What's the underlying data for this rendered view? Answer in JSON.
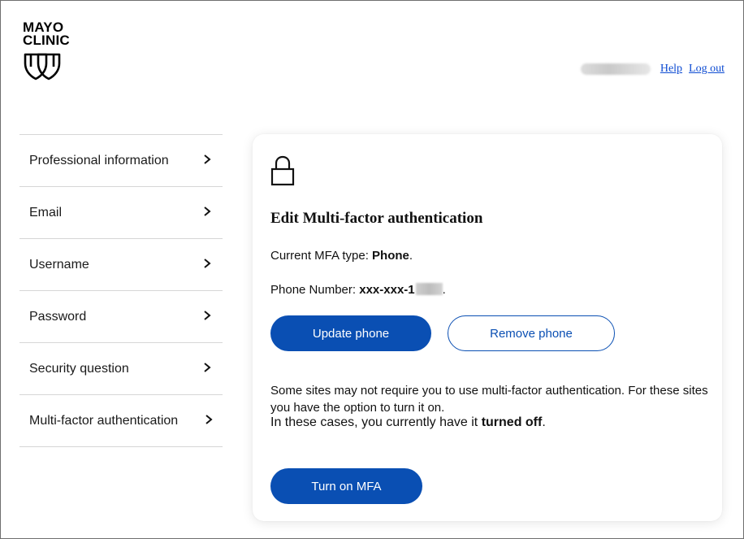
{
  "header": {
    "logo_line1": "MAYO",
    "logo_line2": "CLINIC",
    "help_label": "Help",
    "logout_label": "Log out"
  },
  "sidebar": {
    "items": [
      {
        "label": "Professional information"
      },
      {
        "label": "Email"
      },
      {
        "label": "Username"
      },
      {
        "label": "Password"
      },
      {
        "label": "Security question"
      },
      {
        "label": "Multi-factor authentication"
      }
    ],
    "chevron": "›"
  },
  "card": {
    "icon": "lock-icon",
    "title": "Edit Multi-factor authentication",
    "mfa_type_prefix": "Current MFA type: ",
    "mfa_type_value": "Phone",
    "mfa_type_suffix": ".",
    "phone_prefix": "Phone Number: ",
    "phone_value": "xxx-xxx-1",
    "phone_suffix": ".",
    "update_phone_label": "Update phone",
    "remove_phone_label": "Remove phone",
    "info_text": "Some sites may not require you to use multi-factor authentication. For these sites you have the option to turn it on.",
    "status_prefix": "In these cases, you currently have it ",
    "status_value": "turned off",
    "status_suffix": ".",
    "turn_on_label": "Turn on MFA"
  },
  "colors": {
    "primary": "#0a4fb3",
    "link": "#0d4bd2",
    "divider": "#d6d6d6"
  }
}
